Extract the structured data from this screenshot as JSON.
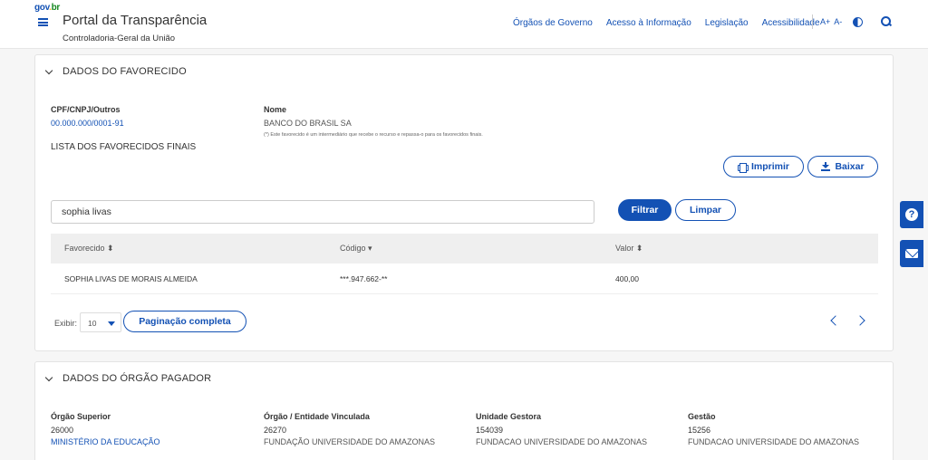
{
  "header": {
    "logo": {
      "g": "gov",
      "dot": ".",
      "br": "br"
    },
    "title": "Portal da Transparência",
    "subtitle": "Controladoria-Geral da União",
    "nav": [
      "Órgãos de Governo",
      "Acesso à Informação",
      "Legislação",
      "Acessibilidade"
    ],
    "font_increase": "A+",
    "font_decrease": "A-"
  },
  "favorecido": {
    "section_title": "DADOS DO FAVORECIDO",
    "cpf_label": "CPF/CNPJ/Outros",
    "cpf_value": "00.000.000/0001-91",
    "nome_label": "Nome",
    "nome_value": "BANCO DO BRASIL SA",
    "note": "(*) Este favorecido é um intermediário que recebe o recurso e repassa-o para os favorecidos finais.",
    "list_title": "LISTA DOS FAVORECIDOS FINAIS",
    "print_label": "Imprimir",
    "download_label": "Baixar",
    "filter_value": "sophia livas",
    "filter_button": "Filtrar",
    "clear_button": "Limpar",
    "table": {
      "headers": [
        "Favorecido ⬍",
        "Código ▾",
        "Valor ⬍"
      ],
      "rows": [
        [
          "SOPHIA LIVAS DE MORAIS ALMEIDA",
          "***.947.662-**",
          "400,00"
        ]
      ]
    },
    "exibir_label": "Exibir:",
    "page_size": "10",
    "full_pagination": "Paginação completa"
  },
  "orgao": {
    "section_title": "DADOS DO ÓRGÃO PAGADOR",
    "columns": [
      {
        "label": "Órgão Superior",
        "code": "26000",
        "name": "MINISTÉRIO DA EDUCAÇÃO"
      },
      {
        "label": "Órgão / Entidade Vinculada",
        "code": "26270",
        "name": "FUNDAÇÃO UNIVERSIDADE DO AMAZONAS"
      },
      {
        "label": "Unidade Gestora",
        "code": "154039",
        "name": "FUNDACAO UNIVERSIDADE DO AMAZONAS"
      },
      {
        "label": "Gestão",
        "code": "15256",
        "name": "FUNDACAO UNIVERSIDADE DO AMAZONAS"
      }
    ]
  },
  "colors": {
    "primary": "#1351b4",
    "header_bg": "#efefef"
  }
}
